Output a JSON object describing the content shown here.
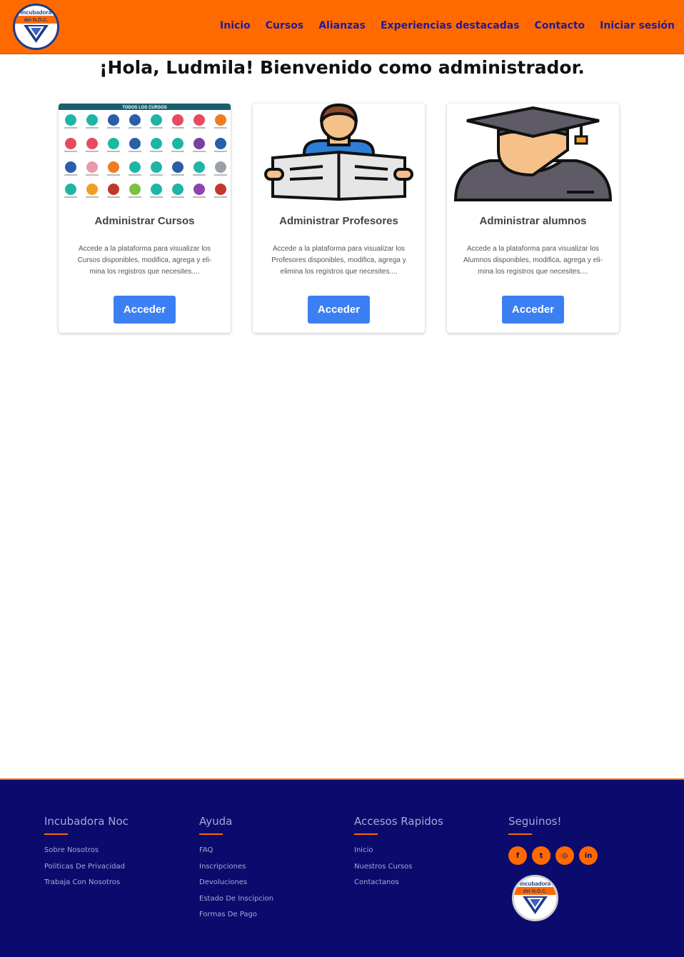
{
  "header": {
    "logo": {
      "line1": "Incubadora",
      "line2": "del N.O.C."
    },
    "nav": [
      {
        "label": "Inicio"
      },
      {
        "label": "Cursos"
      },
      {
        "label": "Alianzas"
      },
      {
        "label": "Experiencias destacadas"
      },
      {
        "label": "Contacto"
      },
      {
        "label": "Iniciar sesión"
      }
    ]
  },
  "main": {
    "greeting": "¡Hola, Ludmila! Bienvenido como administrador.",
    "cards": [
      {
        "image_caption": "TODOS LOS CURSOS",
        "title": "Administrar Cursos",
        "text": "Accede a la plataforma para visualizar los Cursos disponibles, modifica, agrega y eli- mina los registros que necesites....",
        "button": "Acceder"
      },
      {
        "image": "reading-person-icon",
        "title": "Administrar Profesores",
        "text": "Accede a la plataforma para visualizar los Profesores disponibles, modifica, agrega y elimina los registros que necesites....",
        "button": "Acceder"
      },
      {
        "image": "graduate-icon",
        "title": "Administrar alumnos",
        "text": "Accede a la plataforma para visualizar los Alumnos disponibles, modifica, agrega y eli- mina los registros que necesites....",
        "button": "Acceder"
      }
    ]
  },
  "footer": {
    "columns": [
      {
        "title": "Incubadora Noc",
        "links": [
          "Sobre Nosotros",
          "Politicas De Privacidad",
          "Trabaja Con Nosotros"
        ]
      },
      {
        "title": "Ayuda",
        "links": [
          "FAQ",
          "Inscripciones",
          "Devoluciones",
          "Estado De Inscipcion",
          "Formas De Pago"
        ]
      },
      {
        "title": "Accesos Rapidos",
        "links": [
          "Inicio",
          "Nuestros Cursos",
          "Contactanos"
        ]
      },
      {
        "title": "Seguinos!"
      }
    ],
    "social": [
      {
        "icon": "facebook-icon",
        "glyph": "f"
      },
      {
        "icon": "twitter-icon",
        "glyph": "t"
      },
      {
        "icon": "instagram-icon",
        "glyph": "◎"
      },
      {
        "icon": "linkedin-icon",
        "glyph": "in"
      }
    ]
  },
  "colors": {
    "nav_bg": "#ff6a00",
    "nav_link": "#1c1c9e",
    "button": "#3b7ff2",
    "footer_bg": "#0a0b6c",
    "footer_accent": "#ff6a00"
  }
}
